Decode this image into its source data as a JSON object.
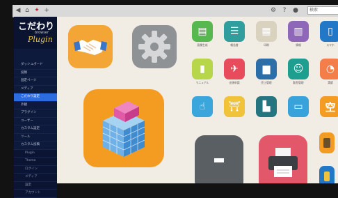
{
  "browser": {
    "search_placeholder": "検索"
  },
  "brand": {
    "main": "こだわり",
    "sub": "browser",
    "script": "Plugin"
  },
  "sidebar": {
    "items": [
      {
        "label": "ダッシュボード",
        "active": false
      },
      {
        "label": "投稿",
        "active": false
      },
      {
        "label": "固定ページ",
        "active": false
      },
      {
        "label": "メディア",
        "active": false
      },
      {
        "label": "こだわり設定",
        "active": true
      },
      {
        "label": "外観",
        "active": false
      },
      {
        "label": "プラグイン",
        "active": false
      },
      {
        "label": "ユーザー",
        "active": false
      },
      {
        "label": "カスタム設定",
        "active": false
      },
      {
        "label": "ツール",
        "active": false
      },
      {
        "label": "カスタム投稿",
        "active": false
      }
    ],
    "sub_items": [
      "Plugin",
      "Theme",
      "ログイン",
      "メディア",
      "設定",
      "アカウント"
    ]
  },
  "apps": [
    {
      "label": "画像生成",
      "icon": "id-card-icon",
      "color": "#57b84f"
    },
    {
      "label": "報告書",
      "icon": "document-icon",
      "color": "#2f9e9d"
    },
    {
      "label": "印刷",
      "icon": "fax-icon",
      "color": "#d8d2bf"
    },
    {
      "label": "情報",
      "icon": "book-icon",
      "color": "#8f67b8"
    },
    {
      "label": "スマホ",
      "icon": "smartphone-icon",
      "color": "#2277c6"
    },
    {
      "label": "マニュアル",
      "icon": "books-icon",
      "color": "#b7d64a"
    },
    {
      "label": "出張申請",
      "icon": "airplane-icon",
      "color": "#e84c5c"
    },
    {
      "label": "売上管理",
      "icon": "chart-icon",
      "color": "#2b6ea8"
    },
    {
      "label": "勤怠管理",
      "icon": "person-icon",
      "color": "#1d9e8f"
    },
    {
      "label": "実績",
      "icon": "pie-chart-icon",
      "color": "#f47e4a"
    },
    {
      "label": "",
      "icon": "touch-icon",
      "color": "#3aa6dc"
    },
    {
      "label": "",
      "icon": "torii-icon",
      "color": "#f0c33a"
    },
    {
      "label": "",
      "icon": "factory-icon",
      "color": "#24757f"
    },
    {
      "label": "",
      "icon": "tablet-icon",
      "color": "#37a3da"
    },
    {
      "label": "空",
      "icon": "kanji-icon",
      "color": "#f49b22"
    }
  ]
}
